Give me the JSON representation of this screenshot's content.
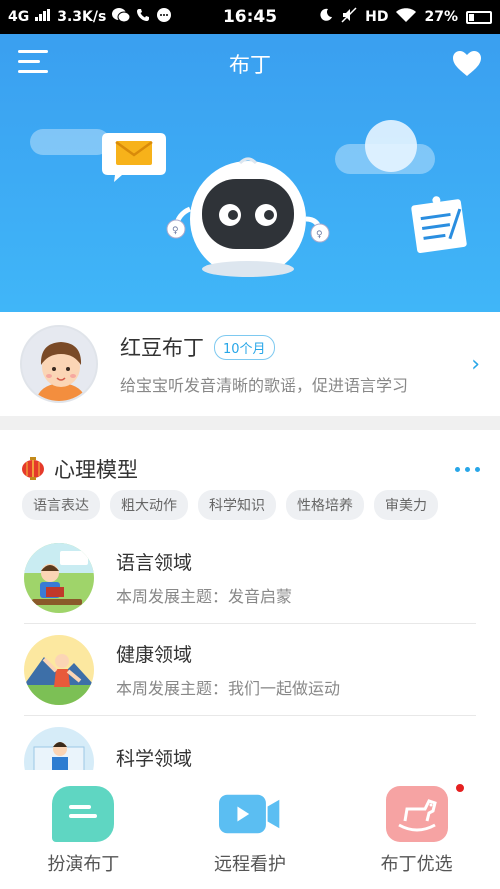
{
  "status_bar": {
    "network": "4G",
    "speed": "3.3K/s",
    "time": "16:45",
    "hd": "HD",
    "battery": "27%"
  },
  "header": {
    "title": "布丁",
    "bg_color": "#3aa8f4"
  },
  "profile": {
    "name": "红豆布丁",
    "age_badge": "10个月",
    "description": "给宝宝听发音清晰的歌谣，促进语言学习"
  },
  "section": {
    "title": "心理模型",
    "tags": [
      "语言表达",
      "粗大动作",
      "科学知识",
      "性格培养",
      "审美力"
    ],
    "items": [
      {
        "title": "语言领域",
        "subtitle": "本周发展主题：发音启蒙",
        "icon": "reading-child-icon"
      },
      {
        "title": "健康领域",
        "subtitle": "本周发展主题：我们一起做运动",
        "icon": "exercise-child-icon"
      },
      {
        "title": "科学领域",
        "subtitle": "",
        "icon": "science-child-icon"
      }
    ]
  },
  "tabbar": {
    "tabs": [
      {
        "label": "扮演布丁",
        "icon": "chat-bubble-icon",
        "color": "#5fd6c2"
      },
      {
        "label": "远程看护",
        "icon": "video-camera-icon",
        "color": "#5bbef2"
      },
      {
        "label": "布丁优选",
        "icon": "rocking-horse-icon",
        "color": "#f6a3a3"
      }
    ]
  },
  "colors": {
    "accent": "#27a6e8",
    "badge_red": "#e52020"
  }
}
